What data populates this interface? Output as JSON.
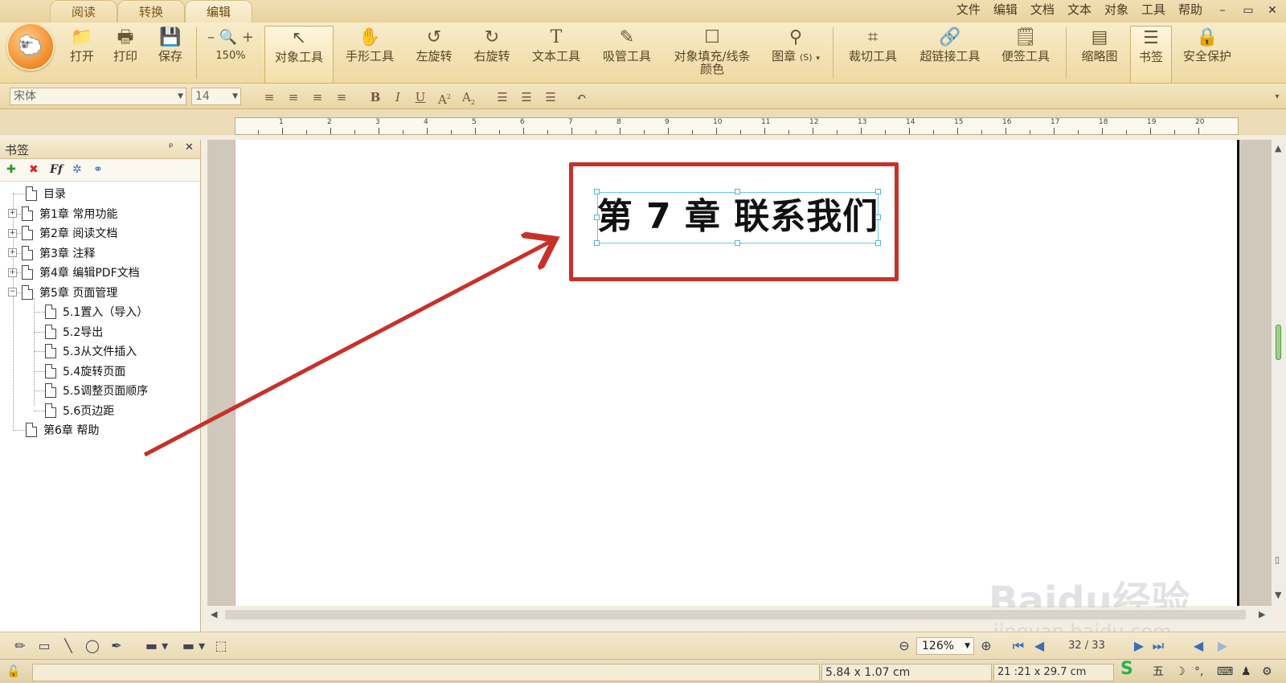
{
  "tabs": [
    {
      "label": "阅读"
    },
    {
      "label": "转换"
    },
    {
      "label": "编辑"
    }
  ],
  "menu": [
    "文件",
    "编辑",
    "文档",
    "文本",
    "对象",
    "工具",
    "帮助"
  ],
  "window_controls": {
    "minimize": "–",
    "maximize": "▭",
    "close": "✕"
  },
  "ribbon": {
    "open": "打开",
    "print": "打印",
    "save": "保存",
    "zoom_minus": "–",
    "zoom_plus": "+",
    "zoom_level": "150%",
    "object_tool": "对象工具",
    "hand_tool": "手形工具",
    "rotate_left": "左旋转",
    "rotate_right": "右旋转",
    "text_tool": "文本工具",
    "eyedropper_tool": "吸管工具",
    "fill_stroke_line1": "对象填充/线条",
    "fill_stroke_line2": "颜色",
    "stamp": "图章",
    "stamp_shortcut": "(S)",
    "crop_tool": "裁切工具",
    "hyperlink_tool": "超链接工具",
    "note_tool": "便签工具",
    "thumbnails": "缩略图",
    "bookmarks": "书签",
    "security": "安全保护"
  },
  "format": {
    "font": "宋体",
    "font_size": "14",
    "bold": "B",
    "italic": "I",
    "underline": "U",
    "superscript": "A",
    "subscript": "A"
  },
  "ruler": {
    "numbers": [
      "1",
      "2",
      "3",
      "4",
      "5",
      "6",
      "7",
      "8",
      "9",
      "10",
      "11",
      "12",
      "13",
      "14",
      "15",
      "16",
      "17",
      "18",
      "19",
      "20"
    ]
  },
  "bookmark_panel": {
    "title": "书签",
    "pin": "ᵖ",
    "close": "✕",
    "items": [
      {
        "label": "目录"
      },
      {
        "label": "第1章 常用功能"
      },
      {
        "label": "第2章 阅读文档"
      },
      {
        "label": "第3章 注释"
      },
      {
        "label": "第4章 编辑PDF文档"
      },
      {
        "label": "第5章 页面管理"
      },
      {
        "label": "5.1置入（导入）"
      },
      {
        "label": "5.2导出"
      },
      {
        "label": "5.3从文件插入"
      },
      {
        "label": "5.4旋转页面"
      },
      {
        "label": "5.5调整页面顺序"
      },
      {
        "label": "5.6页边距"
      },
      {
        "label": "第6章 帮助"
      }
    ]
  },
  "document": {
    "heading": "第 7 章  联系我们",
    "annotation_color": "#c8312a"
  },
  "drawbar": {
    "zoom": "126%",
    "page": "32 / 33"
  },
  "status": {
    "selection_size": "5.84 x 1.07 cm",
    "page_size": "21 :21 x 29.7 cm",
    "ime_wubi": "五"
  },
  "watermark": {
    "brand": "Baidu经验",
    "url": "jingyan.baidu.com"
  }
}
